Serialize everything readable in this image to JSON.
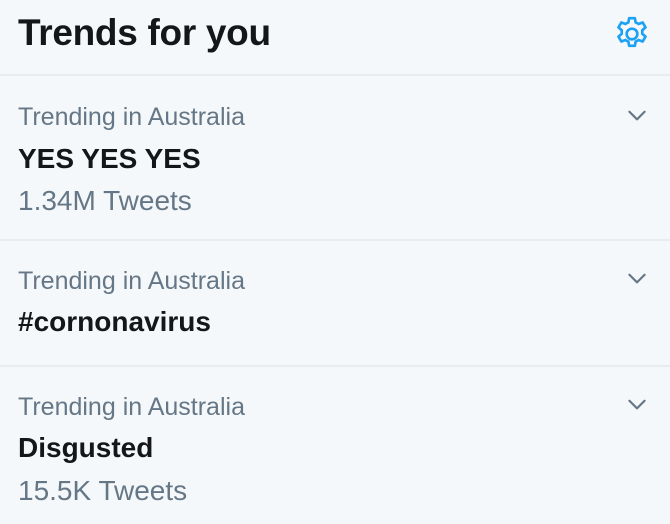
{
  "header": {
    "title": "Trends for you",
    "settings_icon": "gear-icon",
    "accent_color": "#1da1f2"
  },
  "trends": [
    {
      "context": "Trending in Australia",
      "name": "YES YES YES",
      "count": "1.34M Tweets",
      "menu_icon": "chevron-down-icon"
    },
    {
      "context": "Trending in Australia",
      "name": "#cornonavirus",
      "count": "",
      "menu_icon": "chevron-down-icon"
    },
    {
      "context": "Trending in Australia",
      "name": "Disgusted",
      "count": "15.5K Tweets",
      "menu_icon": "chevron-down-icon"
    }
  ]
}
